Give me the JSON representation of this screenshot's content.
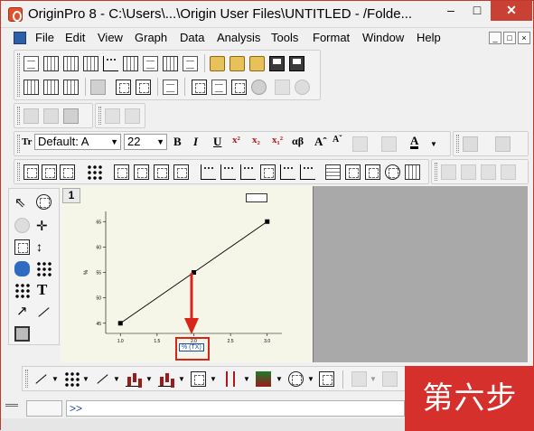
{
  "window": {
    "title": "OriginPro 8 - C:\\Users\\...\\Origin User Files\\UNTITLED - /Folde...",
    "minimize": "–",
    "maximize": "□",
    "close": "✕"
  },
  "menu": [
    "File",
    "Edit",
    "View",
    "Graph",
    "Data",
    "Analysis",
    "Tools",
    "Format",
    "Window",
    "Help"
  ],
  "mdi_controls": [
    "_",
    "□",
    "×"
  ],
  "format_toolbar": {
    "font_prefix": "Tr",
    "font_name": "Default: A",
    "font_size": "22",
    "bold": "B",
    "italic": "I",
    "underline": "U",
    "superscript": "x²",
    "subscript": "x₂",
    "supsub": "x₁²",
    "greek": "αβ",
    "increase_font": "Aˆ",
    "decrease_font": "Aˇ",
    "font_color": "A"
  },
  "tools_toolbar": {
    "text_tool": "T"
  },
  "graph": {
    "window_number": "1",
    "xlabel": "% (TX)",
    "ylabel": "%"
  },
  "chart_data": {
    "type": "line",
    "x": [
      1.0,
      2.0,
      3.0
    ],
    "y": [
      45,
      55,
      65
    ],
    "xlim": [
      0.8,
      3.2
    ],
    "ylim": [
      43,
      67
    ],
    "xticks": [
      "1.0",
      "1.5",
      "2.0",
      "2.5",
      "3.0"
    ],
    "yticks": [
      "45",
      "50",
      "55",
      "60",
      "65"
    ],
    "xlabel": "% (TX)",
    "ylabel": "%",
    "marker": "square",
    "color": "#000000",
    "annotation_color": "#d9241b"
  },
  "command_window": {
    "prompt": ">>"
  },
  "step_badge": "第六步"
}
